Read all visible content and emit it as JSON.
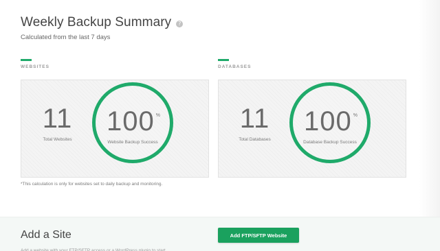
{
  "summary": {
    "title": "Weekly Backup Summary",
    "help_icon_glyph": "?",
    "subtitle": "Calculated from the last 7 days"
  },
  "websites": {
    "section_label": "WEBSITES",
    "count": "11",
    "count_label": "Total Websites",
    "success_value": "100",
    "success_unit": "%",
    "success_label": "Website Backup Success"
  },
  "databases": {
    "section_label": "DATABASES",
    "count": "11",
    "count_label": "Total Databases",
    "success_value": "100",
    "success_unit": "%",
    "success_label": "Database Backup Success"
  },
  "footnote": "*This calculation is only for websites set to daily backup and monitoring.",
  "add_site": {
    "title": "Add a Site",
    "description": "Add a website with your FTP/SFTP access or a WordPress plugin to start",
    "button_label": "Add FTP/SFTP Website"
  },
  "colors": {
    "accent": "#1faa6a",
    "button": "#1aa15e"
  },
  "icons": {
    "help": "help-icon"
  }
}
